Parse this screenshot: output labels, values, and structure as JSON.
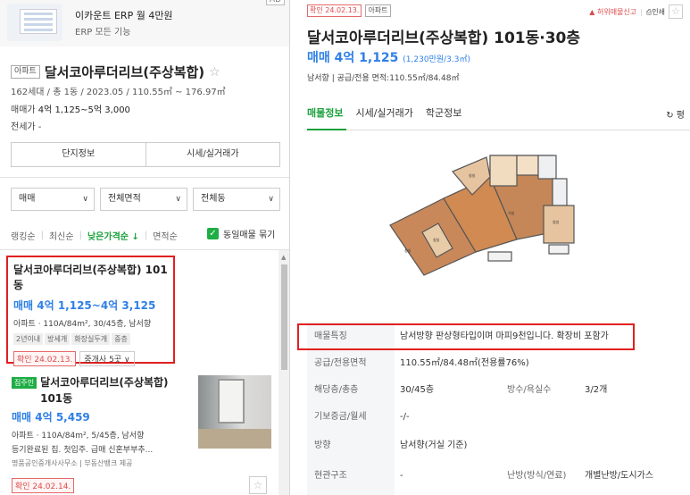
{
  "ad": {
    "title": "이카운트 ERP 월 4만원",
    "subtitle": "ERP 모든 기능",
    "badge": "AD"
  },
  "complex": {
    "type_tag": "아파트",
    "name": "달서코아루더리브(주상복합)",
    "info": "162세대 / 총 1동 / 2023.05 / 110.55㎡ ~ 176.97㎡",
    "trade_label": "매매가",
    "trade_value": "4억 1,125~5억 3,000",
    "jeonse": "전세가 -",
    "buttons": [
      "단지정보",
      "시세/실거래가"
    ]
  },
  "filters": [
    {
      "label": "매매"
    },
    {
      "label": "전체면적"
    },
    {
      "label": "전체동"
    }
  ],
  "sorts": {
    "items": [
      "랭킹순",
      "최신순",
      "낮은가격순 ↓",
      "면적순"
    ],
    "same_listing_toggle": "동일매물 묶기"
  },
  "listings": [
    {
      "title": "달서코아루더리브(주상복합) 101동",
      "price": "매매 4억 1,125~4억 3,125",
      "detail": "아파트 · 110A/84m², 30/45층, 남서향",
      "tags": [
        "2년이내",
        "방세개",
        "화장실두개",
        "중층"
      ],
      "confirm": "확인 24.02.13.",
      "agents": "중개사 5곳"
    },
    {
      "badge": "집주인",
      "title": "달서코아루더리브(주상복합) 101동",
      "price": "매매 4억 5,459",
      "detail": "아파트 · 110A/84m², 5/45층, 남서향",
      "desc": "등기완료된 집. 첫입주. 급매 신혼부부추...",
      "agency": "명품공인중개사사무소 | 부동산뱅크 제공",
      "confirm": "확인 24.02.14."
    }
  ],
  "detail": {
    "confirm": "확인 24.02.13.",
    "type": "아파트",
    "report": "허위매물신고",
    "print": "인쇄",
    "title": "달서코아루더리브(주상복합) 101동·30층",
    "price": "매매 4억 1,125",
    "price_per": "(1,230만원/3.3㎡)",
    "spec": "남서향 | 공급/전용 면적:110.55㎡/84.48㎡",
    "tabs": [
      "매물정보",
      "시세/실거래가",
      "학군정보"
    ],
    "refresh": "↻ 평",
    "rows": [
      {
        "label": "매물특징",
        "value": "남서방향 판상형타입이며 마피9천입니다. 확장비 포함가"
      },
      {
        "label": "공급/전용면적",
        "value": "110.55㎡/84.48㎡(전용률76%)"
      },
      {
        "label": "해당층/총층",
        "value": "30/45층",
        "label2": "방수/욕실수",
        "value2": "3/2개"
      },
      {
        "label": "기보증금/월세",
        "value": "-/-"
      },
      {
        "label": "방향",
        "value": "남서향(거실 기준)"
      },
      {
        "label": "현관구조",
        "value": "-",
        "label2": "난방(방식/연료)",
        "value2": "개별난방/도시가스"
      }
    ]
  },
  "colors": {
    "accent_green": "#1ca13c",
    "price_blue": "#2f7fe6",
    "highlight_red": "#e0201f"
  }
}
